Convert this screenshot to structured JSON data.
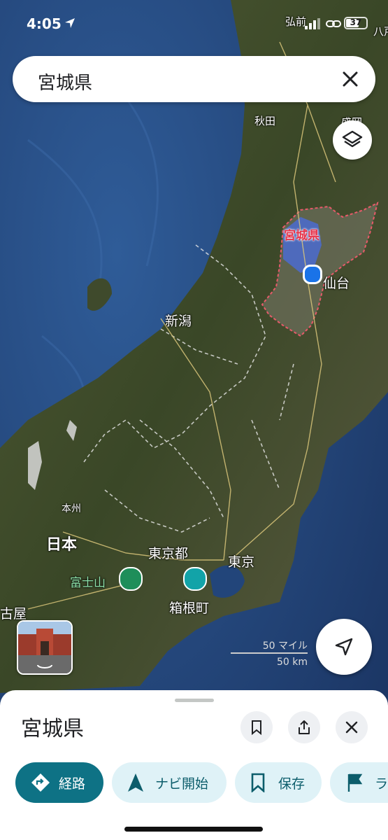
{
  "status_bar": {
    "time": "4:05",
    "battery": "37"
  },
  "search": {
    "query": "宮城県"
  },
  "map": {
    "labels": {
      "hirosaki": "弘前",
      "hachinohe": "八戸",
      "akita": "秋田",
      "morioka": "盛岡",
      "miyagi": "宮城県",
      "sendai": "仙台",
      "niigata": "新潟",
      "honshu": "本州",
      "nihon": "日本",
      "tokyo_to": "東京都",
      "tokyo": "東京",
      "fuji": "富士山",
      "hakone": "箱根町",
      "nagoya": "古屋"
    },
    "scale": {
      "imperial": "50 マイル",
      "metric": "50 km"
    }
  },
  "sheet": {
    "title": "宮城県",
    "actions": {
      "directions": "経路",
      "start_navigation": "ナビ開始",
      "save": "保存",
      "label": "ラ"
    }
  },
  "colors": {
    "accent": "#0e7285",
    "chip_bg": "#dff2f7",
    "region_highlight": "#4a6bd8",
    "boundary": "#e85a6a"
  }
}
